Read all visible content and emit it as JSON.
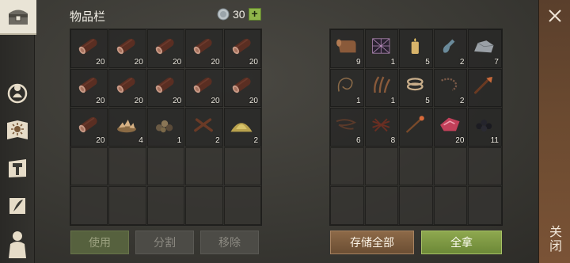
{
  "inventory": {
    "title": "物品栏",
    "currency": "30",
    "currency_plus": "+",
    "slots": [
      {
        "item": "wood-log",
        "qty": "20"
      },
      {
        "item": "wood-log",
        "qty": "20"
      },
      {
        "item": "wood-log",
        "qty": "20"
      },
      {
        "item": "wood-log",
        "qty": "20"
      },
      {
        "item": "wood-log",
        "qty": "20"
      },
      {
        "item": "wood-log",
        "qty": "20"
      },
      {
        "item": "wood-log",
        "qty": "20"
      },
      {
        "item": "wood-log",
        "qty": "20"
      },
      {
        "item": "wood-log",
        "qty": "20"
      },
      {
        "item": "wood-log",
        "qty": "20"
      },
      {
        "item": "wood-log",
        "qty": "20"
      },
      {
        "item": "wood-chips",
        "qty": "4"
      },
      {
        "item": "ore-pebbles",
        "qty": "1"
      },
      {
        "item": "crossed-sticks",
        "qty": "2"
      },
      {
        "item": "sand-pile",
        "qty": "2"
      },
      {
        "item": "",
        "qty": ""
      },
      {
        "item": "",
        "qty": ""
      },
      {
        "item": "",
        "qty": ""
      },
      {
        "item": "",
        "qty": ""
      },
      {
        "item": "",
        "qty": ""
      },
      {
        "item": "",
        "qty": ""
      },
      {
        "item": "",
        "qty": ""
      },
      {
        "item": "",
        "qty": ""
      },
      {
        "item": "",
        "qty": ""
      },
      {
        "item": "",
        "qty": ""
      }
    ],
    "buttons": {
      "use": "使用",
      "split": "分割",
      "remove": "移除"
    }
  },
  "storage": {
    "slots": [
      {
        "item": "leather-roll",
        "qty": "9"
      },
      {
        "item": "net",
        "qty": "1"
      },
      {
        "item": "candle",
        "qty": "5"
      },
      {
        "item": "bottle",
        "qty": "2"
      },
      {
        "item": "stone-ore",
        "qty": "7"
      },
      {
        "item": "rope-coil",
        "qty": "1"
      },
      {
        "item": "plant-fiber",
        "qty": "1"
      },
      {
        "item": "rope-bundle",
        "qty": "5"
      },
      {
        "item": "chain",
        "qty": "2"
      },
      {
        "item": "wooden-club",
        "qty": ""
      },
      {
        "item": "vines",
        "qty": "6"
      },
      {
        "item": "thorn-bundle",
        "qty": "8"
      },
      {
        "item": "staff",
        "qty": ""
      },
      {
        "item": "raw-meat",
        "qty": "20"
      },
      {
        "item": "berries",
        "qty": "11"
      },
      {
        "item": "",
        "qty": ""
      },
      {
        "item": "",
        "qty": ""
      },
      {
        "item": "",
        "qty": ""
      },
      {
        "item": "",
        "qty": ""
      },
      {
        "item": "",
        "qty": ""
      },
      {
        "item": "",
        "qty": ""
      },
      {
        "item": "",
        "qty": ""
      },
      {
        "item": "",
        "qty": ""
      },
      {
        "item": "",
        "qty": ""
      },
      {
        "item": "",
        "qty": ""
      }
    ],
    "buttons": {
      "store_all": "存储全部",
      "take_all": "全拿"
    }
  },
  "close": {
    "label": "关闭"
  },
  "colors": {
    "accent_green": "#8fb54a",
    "accent_brown": "#7b5a3c"
  }
}
